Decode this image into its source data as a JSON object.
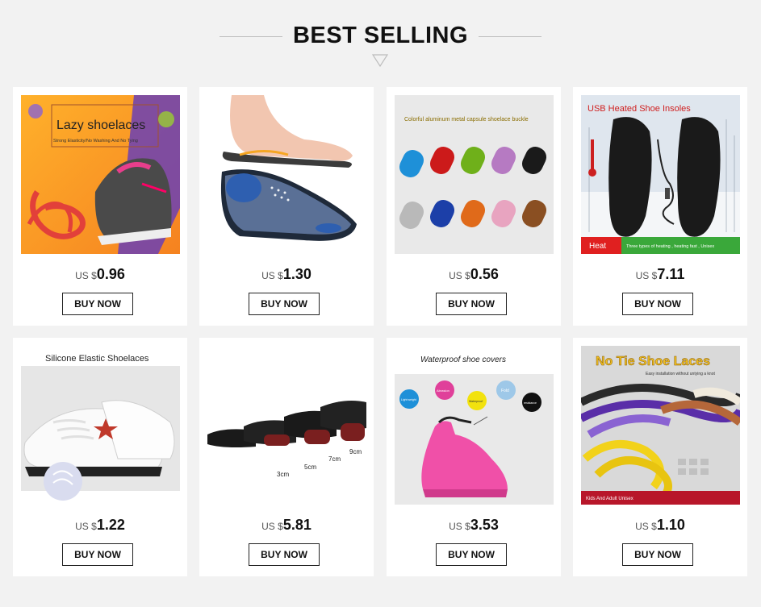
{
  "section": {
    "title": "BEST SELLING"
  },
  "products": [
    {
      "price_currency": "US $",
      "price": "0.96",
      "button": "BUY NOW",
      "image_text": {
        "title": "Lazy shoelaces",
        "subtitle": "Strong Elasticity/No Washing And No Tying"
      }
    },
    {
      "price_currency": "US $",
      "price": "1.30",
      "button": "BUY NOW"
    },
    {
      "price_currency": "US $",
      "price": "0.56",
      "button": "BUY NOW",
      "image_text": {
        "title": "Colorful aluminum metal capsule shoelace buckle"
      }
    },
    {
      "price_currency": "US $",
      "price": "7.11",
      "button": "BUY NOW",
      "image_text": {
        "title": "USB Heated Shoe Insoles",
        "tag": "Heat",
        "footer": "Three types of heating , heating fast , Unisex"
      }
    },
    {
      "price_currency": "US $",
      "price": "1.22",
      "button": "BUY NOW",
      "image_text": {
        "title": "Silicone Elastic Shoelaces"
      }
    },
    {
      "price_currency": "US $",
      "price": "5.81",
      "button": "BUY NOW",
      "image_text": {
        "s1": "3cm",
        "s2": "5cm",
        "s3": "7cm",
        "s4": "9cm"
      }
    },
    {
      "price_currency": "US $",
      "price": "3.53",
      "button": "BUY NOW",
      "image_text": {
        "title": "Waterproof shoe covers",
        "f1": "Light weight",
        "f2": "Abrasion",
        "f3": "Waterproof",
        "f4": "Fold",
        "f5": "resistance"
      }
    },
    {
      "price_currency": "US $",
      "price": "1.10",
      "button": "BUY NOW",
      "image_text": {
        "title": "No Tie Shoe Laces",
        "subtitle": "Easy installation without untying a knot",
        "footer": "Kids And Adult Unisex"
      }
    }
  ],
  "colors": {
    "background": "#f2f2f2",
    "card": "#ffffff",
    "accent_orange": "#f7931e",
    "heat_red": "#e02020",
    "heat_green": "#3aa83a"
  },
  "icons": {
    "section_divider": "down-triangle-outline-icon"
  }
}
